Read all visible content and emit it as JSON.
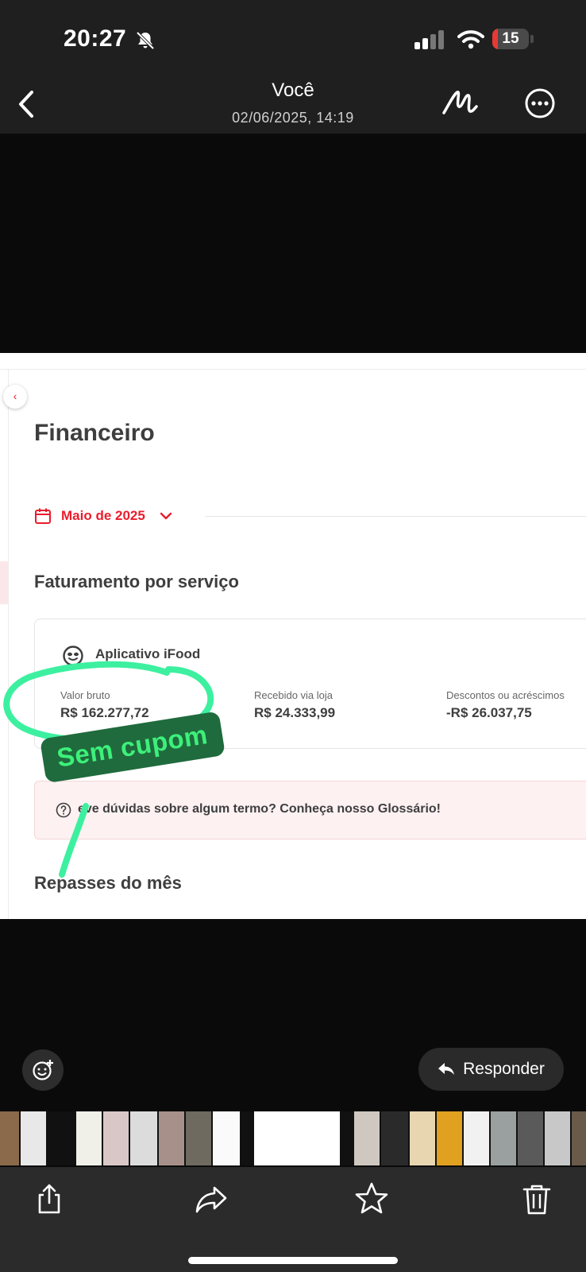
{
  "status_bar": {
    "time": "20:27",
    "battery_level": "15",
    "battery_fraction": 0.15,
    "icons": [
      "bell-slash-icon",
      "signal-icon",
      "wifi-icon",
      "battery-icon"
    ]
  },
  "viewer": {
    "title": "Você",
    "date": "02/06/2025, 14:19"
  },
  "screenshot": {
    "page_title": "Financeiro",
    "month": "Maio de 2025",
    "section_title": "Faturamento por serviço",
    "card": {
      "app_name": "Aplicativo iFood",
      "metrics": [
        {
          "label": "Valor bruto",
          "value": "R$ 162.277,72"
        },
        {
          "label": "Recebido via loja",
          "value": "R$ 24.333,99"
        },
        {
          "label": "Descontos ou acréscimos",
          "value": "-R$ 26.037,75"
        }
      ]
    },
    "glossary_text": "eve dúvidas sobre algum termo? Conheça nosso Glossário!",
    "repasses_title": "Repasses do mês"
  },
  "annotation": {
    "sticker_text": "Sem cupom",
    "sticker_color": "#3df07a",
    "sticker_bg": "#1f6b3d",
    "stroke_color": "#3cf0a0"
  },
  "controls": {
    "reply_label": "Responder"
  },
  "thumbnails": [
    {
      "w": 24,
      "color": "#8a6a4a"
    },
    {
      "w": 32,
      "color": "#e8e8e8"
    },
    {
      "w": 34,
      "color": "#111111"
    },
    {
      "w": 32,
      "color": "#f0efe8"
    },
    {
      "w": 32,
      "color": "#d9c7c7"
    },
    {
      "w": 34,
      "color": "#dcdcdc"
    },
    {
      "w": 32,
      "color": "#a8908a"
    },
    {
      "w": 32,
      "color": "#6e6a60"
    },
    {
      "w": 34,
      "color": "#fafafa"
    },
    {
      "w": 14,
      "color": "#111111"
    },
    {
      "w": 108,
      "color": "#ffffff"
    },
    {
      "w": 14,
      "color": "#111111"
    },
    {
      "w": 32,
      "color": "#cfc8c0"
    },
    {
      "w": 34,
      "color": "#2a2a2a"
    },
    {
      "w": 32,
      "color": "#e8d6b0"
    },
    {
      "w": 32,
      "color": "#e0a020"
    },
    {
      "w": 32,
      "color": "#f1f1f1"
    },
    {
      "w": 32,
      "color": "#9aa0a0"
    },
    {
      "w": 32,
      "color": "#5a5a5a"
    },
    {
      "w": 32,
      "color": "#c8c8c8"
    },
    {
      "w": 34,
      "color": "#6a5a4a"
    },
    {
      "w": 30,
      "color": "#dcdcdc"
    }
  ],
  "toolbar": {
    "icons": [
      "share-icon",
      "forward-icon",
      "star-icon",
      "trash-icon"
    ]
  }
}
